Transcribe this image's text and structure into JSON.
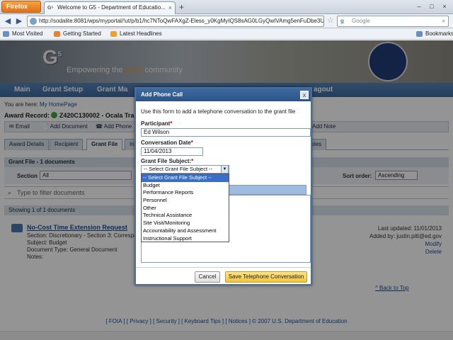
{
  "browser": {
    "app_button": "Firefox",
    "tab_favicon": "G⁵",
    "tab_title": "Welcome to G5 - Department of Educatio...",
    "new_tab": "+",
    "url": "http://sodalite:8081/wps/myportal/!ut/p/b1/hc7NToQwFAXgZ-Eless_y0KgMyIQS8sAG0LGyQwIVAmg5enFuDbe3U...",
    "search_placeholder": "Google",
    "bookmarks": [
      "Most Visited",
      "Getting Started",
      "Latest Headlines"
    ],
    "bookmarks_menu": "Bookmarks"
  },
  "site": {
    "logo": "G",
    "logo_sup": "5",
    "tagline_pre": "Empowering the ",
    "tagline_em": "grant",
    "tagline_post": " community",
    "nav": [
      "Main",
      "Grant Setup",
      "Grant Ma",
      "agout"
    ],
    "breadcrumb_prefix": "You are here:",
    "breadcrumb_link": "My HomePage",
    "award_record": "Award Record: ",
    "award_code": "Z420C130002 - Ocala Traini",
    "toolbar": [
      "Email",
      "Add Document",
      "Add Phone",
      "Add Note"
    ],
    "subtabs": [
      "Award Details",
      "Recipient",
      "Grant File",
      "In",
      "otes"
    ],
    "panel_title": "Grant File - 1 documents",
    "section_label": "Section",
    "section_value": "All",
    "sort_label": "Sort order:",
    "sort_value": "Ascending",
    "filter_placeholder": "Type to filter documents",
    "showing": "Showing 1 of 1 documents",
    "doc": {
      "title": "No-Cost Time Extension Request",
      "section": "Section: Discretionary - Section 3: Correspo",
      "subject": "Subject: Budget",
      "type": "Document Type: General Document",
      "notes": "Notes:",
      "last_updated": "Last updated: 11/01/2013",
      "added_by": "Added by: justin.pitt@ed.gov",
      "modify": "Modify",
      "delete": "Delete"
    },
    "back_to_top": "^ Back to Top",
    "footer": "[ FOIA ] [ Privacy ] [ Security ] [ Keyboard Tips ] [ Notices ] © 2007 U.S. Department of Education"
  },
  "modal": {
    "title": "Add Phone Call",
    "close": "x",
    "intro": "Use this form to add a telephone conversation to the grant file",
    "participant_label": "Participant",
    "participant_value": "Ed Wilson",
    "date_label": "Conversation Date",
    "date_value": "11/04/2013",
    "subject_label": "Grant File Subject:",
    "subject_value": "-- Select Grant File Subject --",
    "subject_options": [
      "-- Select Grant File Subject --",
      "Budget",
      "Performance Reports",
      "Personnel",
      "Other",
      "Technical Assistance",
      "Site Visit/Monitoring",
      "Accountability and Assessment",
      "Instructional Support"
    ],
    "cancel": "Cancel",
    "save": "Save Telephone Conversation",
    "required_mark": "*"
  },
  "colors": {
    "accent": "#3e6aa0",
    "save_button": "#f3c43a",
    "required": "#cc0000"
  }
}
